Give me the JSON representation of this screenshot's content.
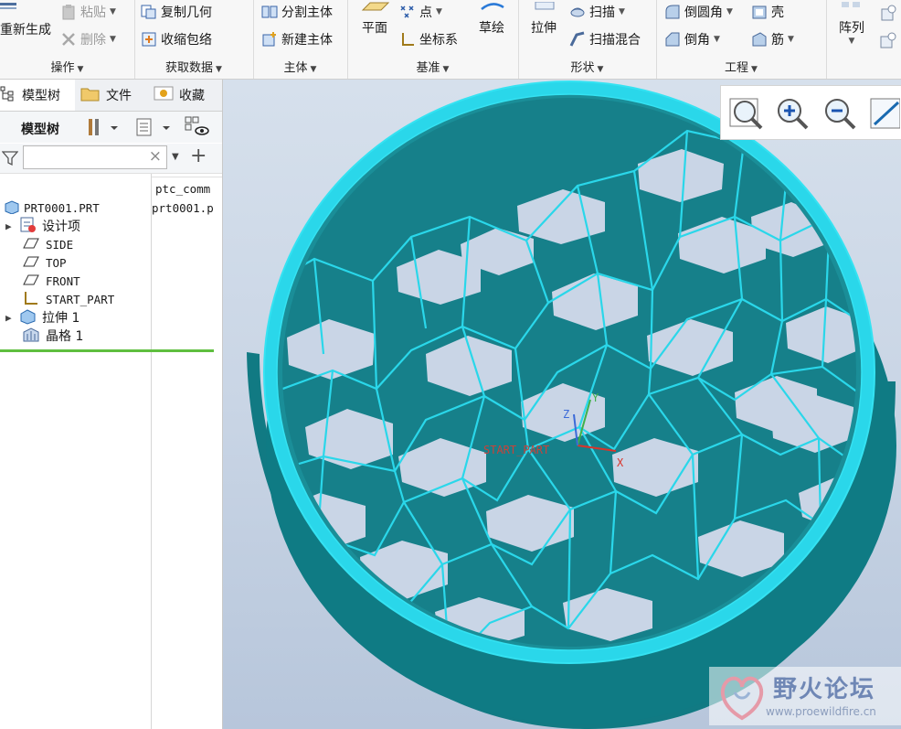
{
  "ribbon": {
    "ops": {
      "regen": "重新生成",
      "paste": "粘贴",
      "delete": "删除",
      "label": "操作"
    },
    "getdata": {
      "copy_geom": "复制几何",
      "shrinkwrap": "收缩包络",
      "label": "获取数据"
    },
    "body": {
      "split": "分割主体",
      "new": "新建主体",
      "label": "主体"
    },
    "datum": {
      "plane": "平面",
      "point": "点",
      "csys": "坐标系",
      "sketch": "草绘",
      "label": "基准"
    },
    "shape": {
      "extrude": "拉伸",
      "sweep": "扫描",
      "swept_blend": "扫描混合",
      "label": "形状"
    },
    "engineering": {
      "round": "倒圆角",
      "chamfer": "倒角",
      "shell": "壳",
      "rib": "筋",
      "label": "工程"
    },
    "pattern": {
      "label": "阵列"
    }
  },
  "left_panel": {
    "tabs": [
      "模型树",
      "文件",
      "收藏"
    ],
    "tree_title": "模型树",
    "search": {
      "value": "",
      "clear": "×"
    },
    "column_header": "ptc_comm",
    "column_value": "prt0001.p",
    "tree_items": [
      {
        "label": "PRT0001.PRT",
        "icon": "part-icon"
      },
      {
        "label": "设计项",
        "icon": "design-items-icon",
        "expandable": true
      },
      {
        "label": "SIDE",
        "icon": "datum-plane-icon"
      },
      {
        "label": "TOP",
        "icon": "datum-plane-icon"
      },
      {
        "label": "FRONT",
        "icon": "datum-plane-icon"
      },
      {
        "label": "START_PART",
        "icon": "csys-icon"
      },
      {
        "label": "拉伸 1",
        "icon": "extrude-icon",
        "expandable": true
      },
      {
        "label": "晶格 1",
        "icon": "lattice-icon"
      }
    ]
  },
  "viewport": {
    "csys_label": "START_PART",
    "axes": {
      "x": "X",
      "y": "Y",
      "z": "Z"
    },
    "model_color": "#19808a",
    "edge_color": "#2ad7ea"
  },
  "view_toolbar": [
    "refit-icon",
    "zoom-in-icon",
    "zoom-out-icon",
    "repaint-icon"
  ],
  "watermark": {
    "name": "野火论坛",
    "url": "www.proewildfire.cn"
  }
}
